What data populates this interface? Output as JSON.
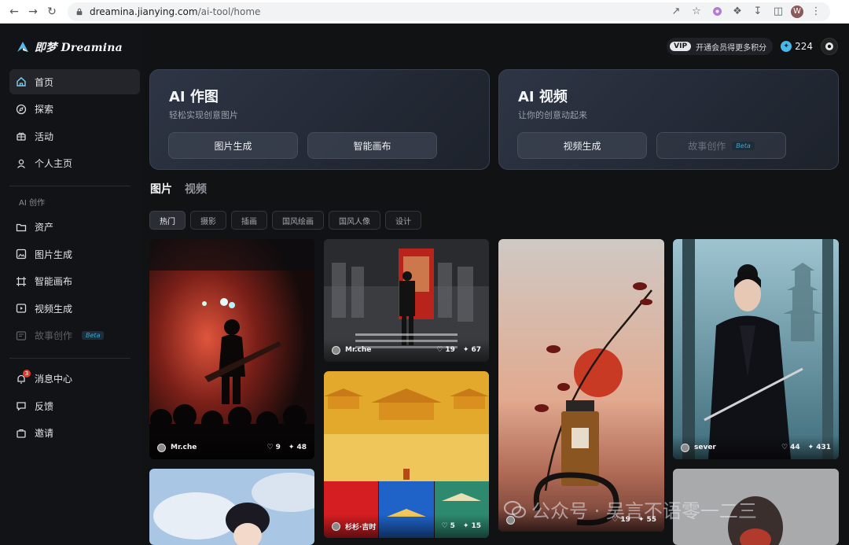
{
  "browser": {
    "url_host": "dreamina.jianying.com",
    "url_path": "/ai-tool/home",
    "profile_initial": "W"
  },
  "app": {
    "logo_text": "即梦 Dreamina"
  },
  "sidebar": {
    "items_top": [
      {
        "label": "首页",
        "icon": "home-icon",
        "active": true
      },
      {
        "label": "探索",
        "icon": "compass-icon"
      },
      {
        "label": "活动",
        "icon": "gift-icon"
      },
      {
        "label": "个人主页",
        "icon": "user-icon"
      }
    ],
    "section_label": "AI 创作",
    "items_create": [
      {
        "label": "资产",
        "icon": "folder-icon"
      },
      {
        "label": "图片生成",
        "icon": "image-gen-icon"
      },
      {
        "label": "智能画布",
        "icon": "canvas-icon"
      },
      {
        "label": "视频生成",
        "icon": "video-icon"
      },
      {
        "label": "故事创作",
        "icon": "story-icon",
        "beta": "Beta",
        "disabled": true
      }
    ],
    "items_bottom": [
      {
        "label": "消息中心",
        "icon": "bell-icon",
        "badge": "3"
      },
      {
        "label": "反馈",
        "icon": "feedback-icon"
      },
      {
        "label": "邀请",
        "icon": "invite-icon"
      }
    ]
  },
  "topbar": {
    "vip_tag": "VIP",
    "vip_text": "开通会员得更多积分",
    "credits": "224"
  },
  "hero": {
    "image": {
      "title": "AI 作图",
      "subtitle": "轻松实现创意图片",
      "buttons": [
        "图片生成",
        "智能画布"
      ]
    },
    "video": {
      "title": "AI 视频",
      "subtitle": "让你的创意动起来",
      "buttons": [
        "视频生成",
        "故事创作"
      ],
      "beta": "Beta"
    }
  },
  "media_tabs": [
    "图片",
    "视频"
  ],
  "chips": [
    "热门",
    "摄影",
    "插画",
    "国风绘画",
    "国风人像",
    "设计"
  ],
  "gallery": [
    {
      "author": "Mr.che",
      "likes": "9",
      "remixes": "48"
    },
    {
      "author": "Mr.che",
      "likes": "19",
      "remixes": "67"
    },
    {
      "author": "",
      "likes": "19",
      "remixes": "55"
    },
    {
      "author": "sever",
      "likes": "44",
      "remixes": "431"
    },
    {
      "author": "杉杉·吉时",
      "likes": "5",
      "remixes": "15"
    }
  ],
  "watermark": "公众号 · 吴言不语零一二三",
  "colors": {
    "background": "#111214",
    "accent": "#49b6e8",
    "badge": "#e2382e"
  }
}
